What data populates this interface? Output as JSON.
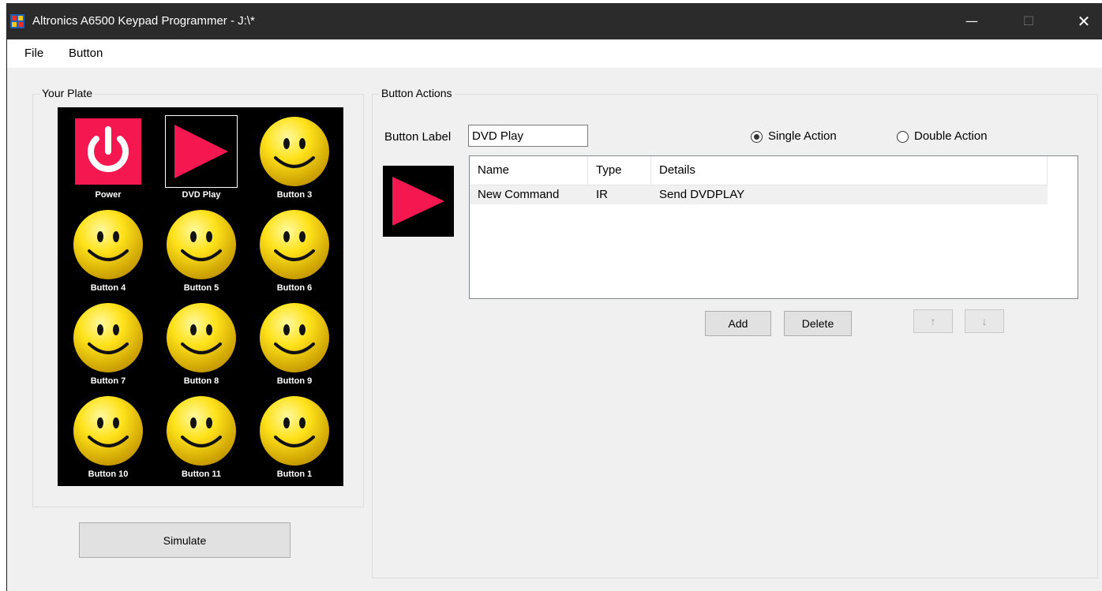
{
  "window": {
    "title": "Altronics A6500 Keypad Programmer - J:\\*"
  },
  "menu": {
    "file": "File",
    "button": "Button"
  },
  "plate": {
    "group_title": "Your Plate",
    "buttons": [
      {
        "label": "Power",
        "icon": "power-icon"
      },
      {
        "label": "DVD Play",
        "icon": "play-icon"
      },
      {
        "label": "Button 3",
        "icon": "smiley-icon"
      },
      {
        "label": "Button 4",
        "icon": "smiley-icon"
      },
      {
        "label": "Button 5",
        "icon": "smiley-icon"
      },
      {
        "label": "Button 6",
        "icon": "smiley-icon"
      },
      {
        "label": "Button 7",
        "icon": "smiley-icon"
      },
      {
        "label": "Button 8",
        "icon": "smiley-icon"
      },
      {
        "label": "Button 9",
        "icon": "smiley-icon"
      },
      {
        "label": "Button 10",
        "icon": "smiley-icon"
      },
      {
        "label": "Button 11",
        "icon": "smiley-icon"
      },
      {
        "label": "Button 1",
        "icon": "smiley-icon"
      }
    ],
    "simulate_label": "Simulate"
  },
  "actions": {
    "group_title": "Button Actions",
    "button_label_caption": "Button Label",
    "button_label_value": "DVD Play",
    "single_action": "Single Action",
    "double_action": "Double Action",
    "selected_mode": "single",
    "columns": [
      "Name",
      "Type",
      "Details"
    ],
    "rows": [
      {
        "name": "New Command",
        "type": "IR",
        "details": "Send DVDPLAY"
      }
    ],
    "add_label": "Add",
    "delete_label": "Delete",
    "up_label": "↑",
    "down_label": "↓"
  },
  "colors": {
    "accent_red": "#f5174f",
    "smiley_yellow": "#ffe21a",
    "titlebar": "#2b2b2b"
  }
}
